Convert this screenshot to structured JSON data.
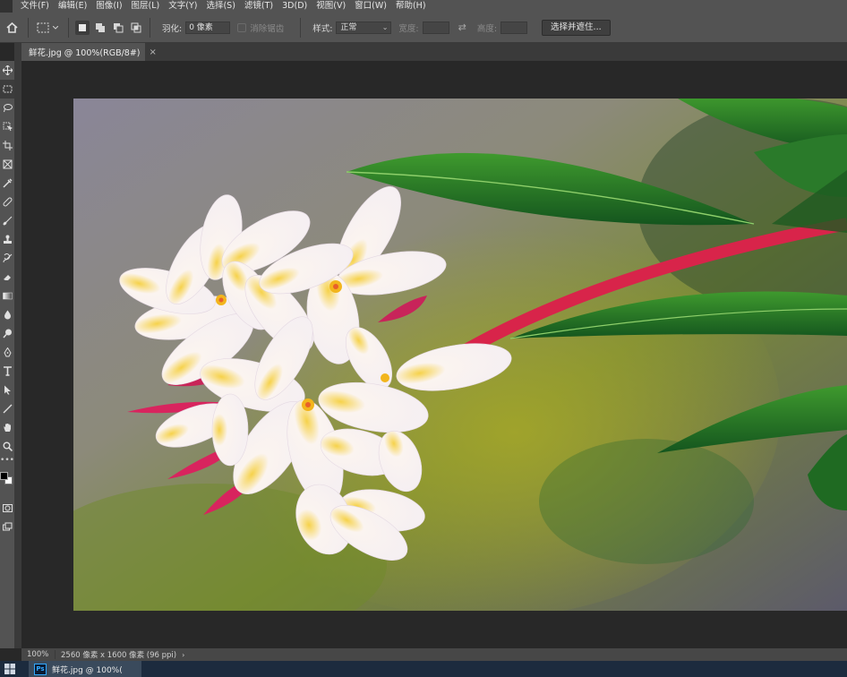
{
  "menubar": {
    "items": [
      "文件(F)",
      "编辑(E)",
      "图像(I)",
      "图层(L)",
      "文字(Y)",
      "选择(S)",
      "滤镜(T)",
      "3D(D)",
      "视图(V)",
      "窗口(W)",
      "帮助(H)"
    ]
  },
  "options": {
    "feather_label": "羽化:",
    "feather_value": "0 像素",
    "antialias_label": "消除锯齿",
    "style_label": "样式:",
    "style_value": "正常",
    "width_label": "宽度:",
    "height_label": "高度:",
    "select_mask_button": "选择并遮住..."
  },
  "document": {
    "tab_title": "鲜花.jpg @ 100%(RGB/8#)",
    "close_symbol": "×"
  },
  "statusbar": {
    "zoom": "100%",
    "doc_info": "2560 像素 x 1600 像素 (96 ppi)",
    "arrow": "›"
  },
  "taskbar": {
    "app_icon_label": "Ps",
    "item_label": "鲜花.jpg @ 100%("
  },
  "colors": {
    "foreground": "#000000",
    "background": "#ffffff"
  }
}
